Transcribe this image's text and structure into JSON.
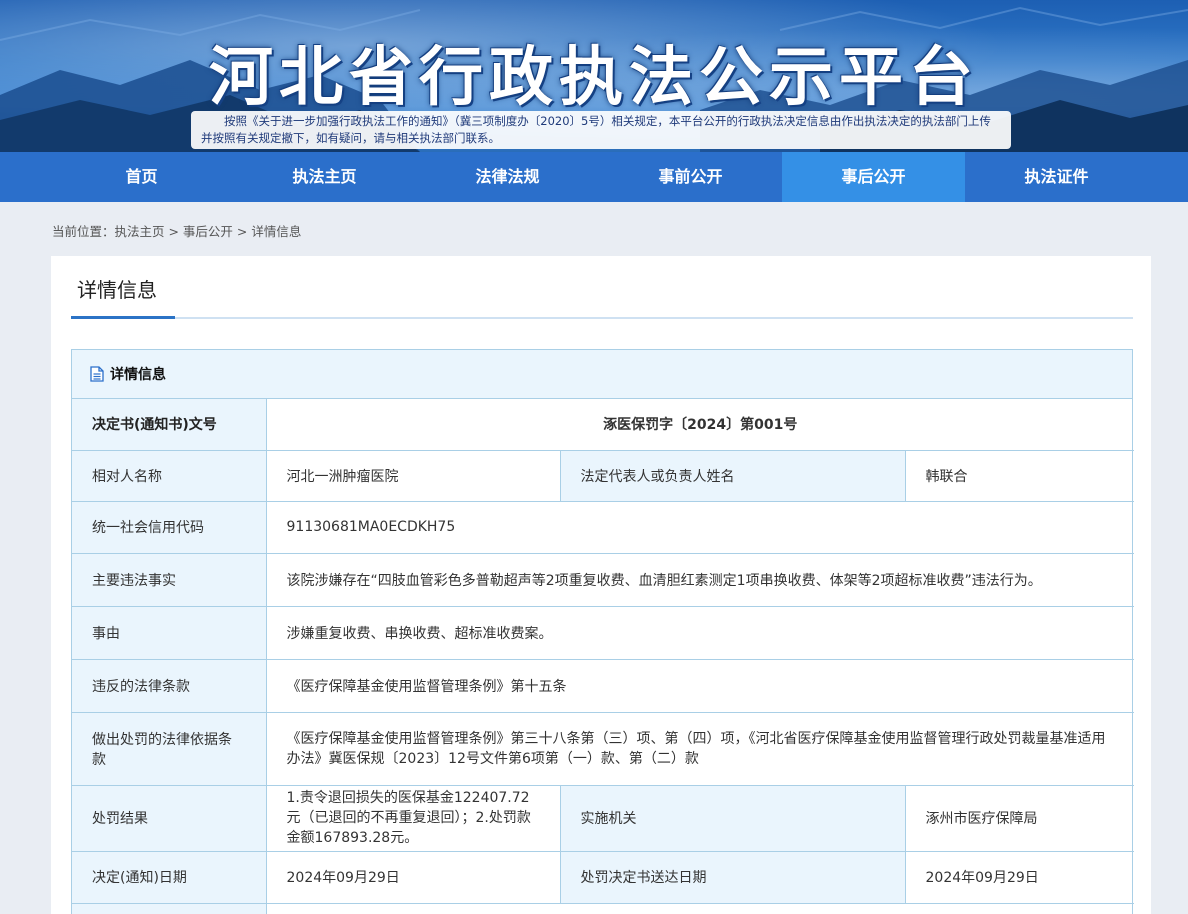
{
  "banner": {
    "title": "河北省行政执法公示平台",
    "notice": "按照《关于进一步加强行政执法工作的通知》（冀三项制度办〔2020〕5号）相关规定，本平台公开的行政执法决定信息由作出执法决定的执法部门上传并按照有关规定撤下，如有疑问，请与相关执法部门联系。"
  },
  "nav": {
    "items": [
      {
        "label": "首页"
      },
      {
        "label": "执法主页"
      },
      {
        "label": "法律法规"
      },
      {
        "label": "事前公开"
      },
      {
        "label": "事后公开",
        "active": true
      },
      {
        "label": "执法证件"
      }
    ]
  },
  "breadcrumb": "当前位置：执法主页 > 事后公开 > 详情信息",
  "panel": {
    "title": "详情信息",
    "section_title": "详情信息"
  },
  "details": {
    "doc_no_label": "决定书(通知书)文号",
    "doc_no": "涿医保罚字〔2024〕第001号",
    "party_label": "相对人名称",
    "party": "河北一洲肿瘤医院",
    "rep_label": "法定代表人或负责人姓名",
    "rep": "韩联合",
    "credit_label": "统一社会信用代码",
    "credit": "91130681MA0ECDKH75",
    "facts_label": "主要违法事实",
    "facts": "该院涉嫌存在“四肢血管彩色多普勒超声等2项重复收费、血清胆红素测定1项串换收费、体架等2项超标准收费”违法行为。",
    "cause_label": "事由",
    "cause": "涉嫌重复收费、串换收费、超标准收费案。",
    "law_label": "违反的法律条款",
    "law": "《医疗保障基金使用监督管理条例》第十五条",
    "basis_label": "做出处罚的法律依据条款",
    "basis": "《医疗保障基金使用监督管理条例》第三十八条第（三）项、第（四）项，《河北省医疗保障基金使用监督管理行政处罚裁量基准适用办法》冀医保规〔2023〕12号文件第6项第（一）款、第（二）款",
    "result_label": "处罚结果",
    "result": "1.责令退回损失的医保基金122407.72元（已退回的不再重复退回）；2.处罚款金额167893.28元。",
    "agency_label": "实施机关",
    "agency": "涿州市医疗保障局",
    "date_label": "决定(通知)日期",
    "date": "2024年09月29日",
    "delivery_label": "处罚决定书送达日期",
    "delivery": "2024年09月29日"
  }
}
